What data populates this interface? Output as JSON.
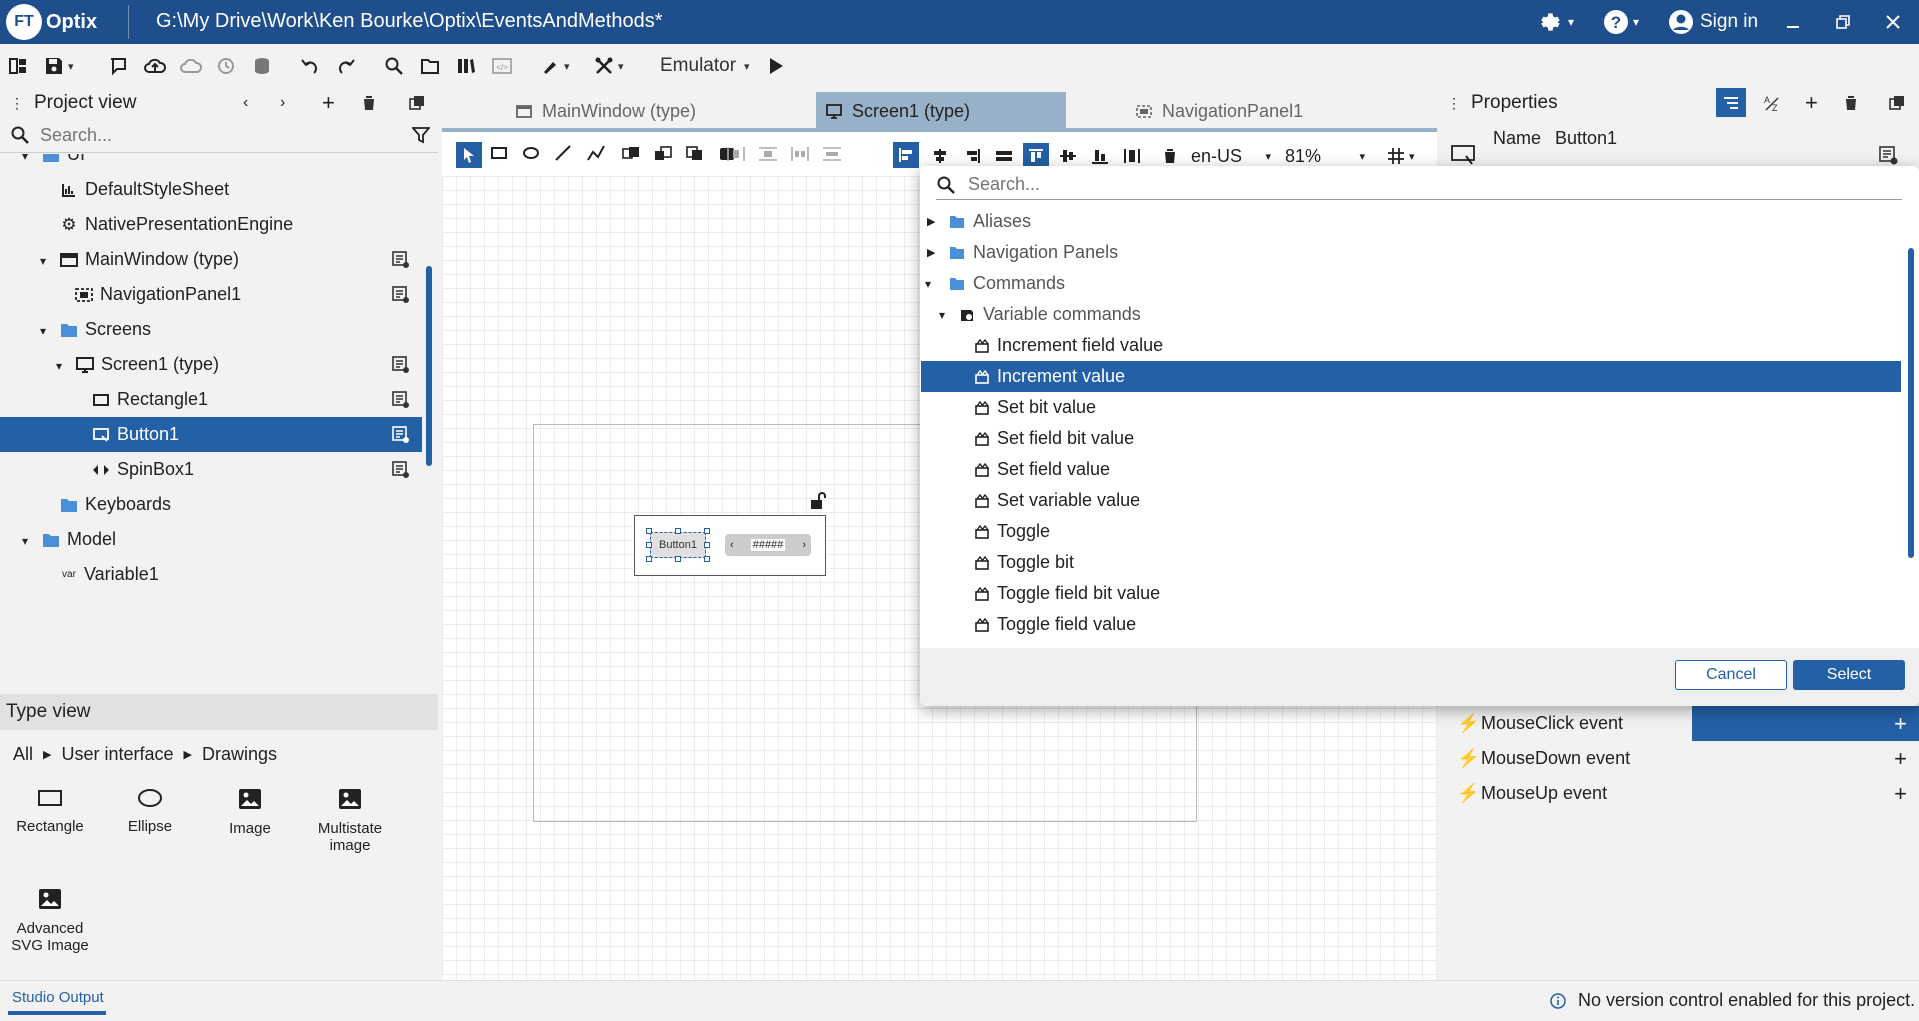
{
  "app": {
    "logo_badge": "FT",
    "logo_name": "Optix",
    "path": "G:\\My Drive\\Work\\Ken Bourke\\Optix\\EventsAndMethods*",
    "sign_in": "Sign in"
  },
  "toolbar": {
    "emulator": "Emulator"
  },
  "project_view": {
    "title": "Project view",
    "search_placeholder": "Search...",
    "tree": [
      {
        "label": "UI",
        "icon": "folder-icon"
      },
      {
        "label": "DefaultStyleSheet",
        "icon": "stylesheet-icon"
      },
      {
        "label": "NativePresentationEngine",
        "icon": "gear-icon"
      },
      {
        "label": "MainWindow (type)",
        "icon": "window-icon"
      },
      {
        "label": "NavigationPanel1",
        "icon": "navigation-panel-icon"
      },
      {
        "label": "Screens",
        "icon": "folder-icon"
      },
      {
        "label": "Screen1 (type)",
        "icon": "screen-icon"
      },
      {
        "label": "Rectangle1",
        "icon": "rectangle-icon"
      },
      {
        "label": "Button1",
        "icon": "button-icon"
      },
      {
        "label": "SpinBox1",
        "icon": "spinbox-icon"
      },
      {
        "label": "Keyboards",
        "icon": "folder-icon"
      },
      {
        "label": "Model",
        "icon": "folder-icon"
      },
      {
        "label": "Variable1",
        "icon": "variable-icon",
        "badge": "var"
      }
    ]
  },
  "type_view": {
    "title": "Type view",
    "breadcrumb": [
      "All",
      "User interface",
      "Drawings"
    ],
    "items": [
      "Rectangle",
      "Ellipse",
      "Image",
      "Multistate image",
      "Advanced SVG Image"
    ]
  },
  "editor": {
    "tabs": [
      "MainWindow (type)",
      "Screen1 (type)",
      "NavigationPanel1"
    ],
    "locale": "en-US",
    "zoom": "81%",
    "canvas_button": "Button1",
    "canvas_spinbox": "#####"
  },
  "properties": {
    "title": "Properties",
    "name_label": "Name",
    "name_value": "Button1",
    "events": [
      "MouseClick event",
      "MouseDown event",
      "MouseUp event"
    ]
  },
  "dialog": {
    "search_placeholder": "Search...",
    "items": [
      {
        "label": "Aliases",
        "type": "folder",
        "level": 0,
        "state": "collapsed"
      },
      {
        "label": "Navigation Panels",
        "type": "folder",
        "level": 0,
        "state": "collapsed"
      },
      {
        "label": "Commands",
        "type": "folder",
        "level": 0,
        "state": "expanded"
      },
      {
        "label": "Variable commands",
        "type": "group",
        "level": 1,
        "state": "expanded"
      },
      {
        "label": "Increment field value",
        "type": "method",
        "level": 2
      },
      {
        "label": "Increment value",
        "type": "method",
        "level": 2,
        "selected": true
      },
      {
        "label": "Set bit value",
        "type": "method",
        "level": 2
      },
      {
        "label": "Set field bit value",
        "type": "method",
        "level": 2
      },
      {
        "label": "Set field value",
        "type": "method",
        "level": 2
      },
      {
        "label": "Set variable value",
        "type": "method",
        "level": 2
      },
      {
        "label": "Toggle",
        "type": "method",
        "level": 2
      },
      {
        "label": "Toggle bit",
        "type": "method",
        "level": 2
      },
      {
        "label": "Toggle field bit value",
        "type": "method",
        "level": 2
      },
      {
        "label": "Toggle field value",
        "type": "method",
        "level": 2
      }
    ],
    "cancel": "Cancel",
    "select": "Select"
  },
  "status": {
    "output_tab": "Studio Output",
    "message": "No version control enabled for this project."
  },
  "colors": {
    "brand": "#1e4f8c",
    "selection": "#2360a5",
    "active_tab": "#97b1c9"
  }
}
